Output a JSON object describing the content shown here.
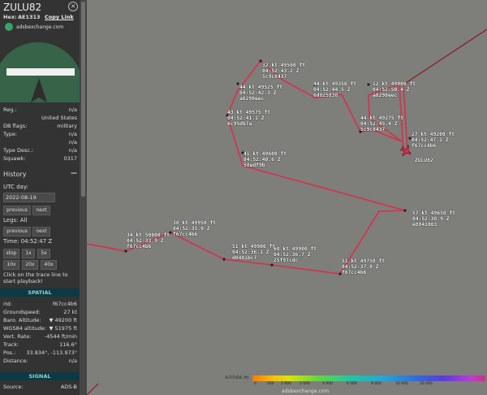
{
  "panel": {
    "callsign": "ZULU82",
    "close_icon": "✕",
    "hex_label": "Hex:",
    "hex_value": "AE1313",
    "copy_link": "Copy Link",
    "site": "adsbexchange.com",
    "photo_icon": "aircraft-silhouette-icon",
    "fields_top": [
      {
        "k": "Reg.:",
        "v": "n/a"
      },
      {
        "k": "",
        "v": "United States"
      },
      {
        "k": "DB flags:",
        "v": "military"
      },
      {
        "k": "Type:",
        "v": "n/a"
      },
      {
        "k": "",
        "v": "n/a"
      },
      {
        "k": "Type Desc.:",
        "v": "n/a"
      },
      {
        "k": "Squawk:",
        "v": "0317"
      }
    ],
    "history_title": "History",
    "history_toggle": "—",
    "utc_day_label": "UTC day:",
    "utc_day_value": "2022-08-19",
    "prev_label": "previous",
    "next_label": "next",
    "legs_label": "Legs: All",
    "time_label": "Time: 04:52:47 Z",
    "stop_label": "stop",
    "speed_1x": "1x",
    "speed_5x": "5x",
    "speed_10x": "10x",
    "speed_20x": "20x",
    "speed_40x": "40x",
    "playback_hint": "Click on the trace line to start playback!",
    "spatial_title": "SPATIAL",
    "fields_spatial": [
      {
        "k": "rId:",
        "v": "f67cc4b6"
      },
      {
        "k": "Groundspeed:",
        "v": "27 kt"
      },
      {
        "k": "Baro. Altitude:",
        "v": "▼ 49200 ft"
      },
      {
        "k": "WGS84 altitude:",
        "v": "▼ 51975 ft"
      },
      {
        "k": "Vert. Rate:",
        "v": "-4544 ft/min"
      },
      {
        "k": "Track:",
        "v": "116.6°"
      },
      {
        "k": "Pos.:",
        "v": "33.834°, -113.973°"
      },
      {
        "k": "Distance:",
        "v": "n/a"
      }
    ],
    "signal_title": "SIGNAL",
    "source_label": "Source:",
    "source_value": "ADS-B"
  },
  "map": {
    "aircraft_label": "ZULU82",
    "altitude_legend_title": "ALTITUDE (ft)",
    "altitude_ticks": [
      "0",
      "500",
      "1 000",
      "2 000",
      "4 000",
      "6 000",
      "8 000",
      "10 000",
      "20 000"
    ],
    "attribution": "adsbexchange.com",
    "trace_color": "#d9304a",
    "points": [
      {
        "lines": [
          "32 kt  49500 ft",
          "04:52:43.2 Z",
          "5c9c8437"
        ]
      },
      {
        "lines": [
          "44 kt  49525 ft",
          "04:52:42.3 Z",
          "a0290eec"
        ]
      },
      {
        "lines": [
          "43 kt  49575 ft",
          "04:52:41.1 Z",
          "6c95db7a"
        ]
      },
      {
        "lines": [
          "41 kt  49600 ft",
          "04:52:40.6 Z",
          "58edf9b"
        ]
      },
      {
        "lines": [
          "44 kt  49350 ft",
          "04:52:44.5 Z",
          "6d825838"
        ]
      },
      {
        "lines": [
          "12 kt  49000 ft",
          "04:52:50.4 Z",
          "a0290eec"
        ]
      },
      {
        "lines": [
          "44 kt  49275 ft",
          "04:52:45.4 Z",
          "5c9c8437"
        ]
      },
      {
        "lines": [
          "27 kt  49200 ft",
          "04:52:47.1 Z",
          "f67cc4b6"
        ]
      },
      {
        "lines": [
          "57 kt  49650 ft",
          "04:52:38.9 Z",
          "e8841003"
        ]
      },
      {
        "lines": [
          "38 kt  49950 ft",
          "04:52:35.0 Z",
          "f67cc4b6"
        ]
      },
      {
        "lines": [
          "34 kt  50000 ft",
          "04:52:33.9 Z",
          "f67cc4b6"
        ]
      },
      {
        "lines": [
          "51 kt  49900 ft",
          "04:52:36.1 Z",
          "d0481bc7"
        ]
      },
      {
        "lines": [
          "60 kt  49900 ft",
          "04:52:36.7 Z",
          "25f97cdc"
        ]
      },
      {
        "lines": [
          "51 kt  49750 ft",
          "04:52:37.8 Z",
          "f67cc4b6"
        ]
      }
    ]
  }
}
